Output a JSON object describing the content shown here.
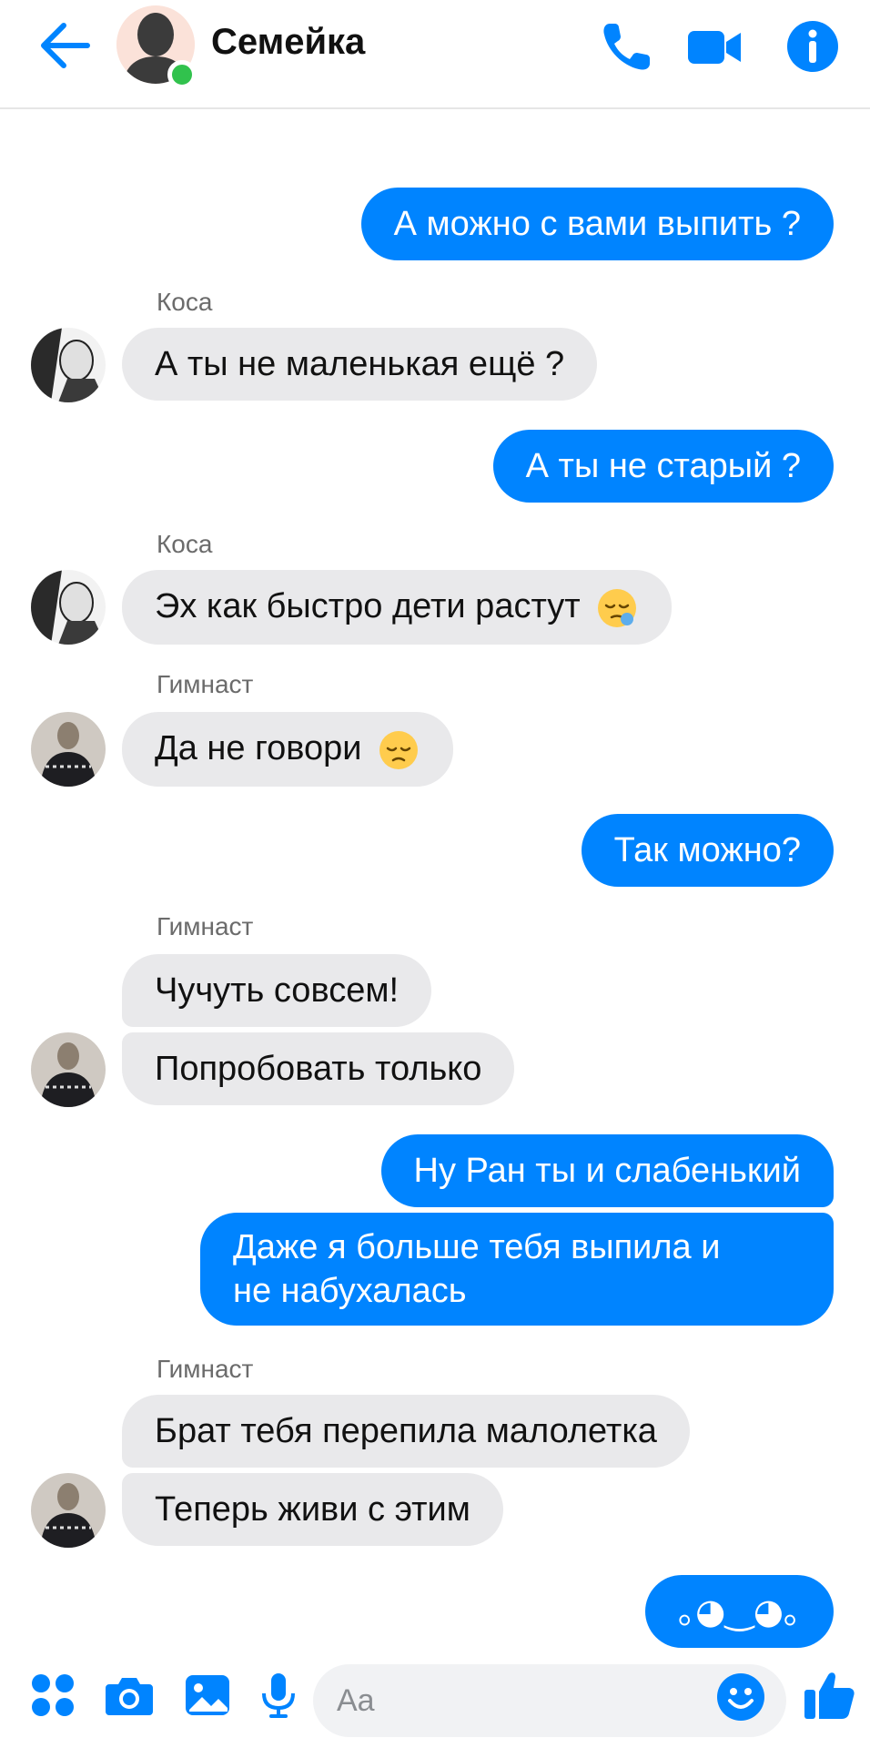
{
  "header": {
    "title": "Семейка",
    "back_icon": "arrow-left-icon",
    "call_icon": "phone-icon",
    "video_icon": "video-camera-icon",
    "info_icon": "info-icon",
    "accent": "#0084ff",
    "online_color": "#31c24d"
  },
  "messages": {
    "m1": "А можно с вами выпить ?",
    "s1": "Коса",
    "m2": "А ты не маленькая ещё ?",
    "m3": "А ты не старый ?",
    "s2": "Коса",
    "m4": "Эх как быстро дети растут",
    "s3": "Гимнаст",
    "m5": "Да не говори",
    "m6": "Так можно?",
    "s4": "Гимнаст",
    "m7": "Чучуть совсем!",
    "m8": "Попробовать только",
    "m9": "Ну Ран ты и слабенький",
    "m10_line1": "Даже я больше тебя выпила и",
    "m10_line2": "не набухалась",
    "s5": "Гимнаст",
    "m11": "Брат тебя перепила малолетка",
    "m12": "Теперь живи с этим",
    "m13": "｡◕‿◕｡"
  },
  "composer": {
    "placeholder": "Aa",
    "icons": [
      "apps-icon",
      "camera-icon",
      "gallery-icon",
      "microphone-icon",
      "emoji-icon",
      "thumbs-up-icon"
    ]
  }
}
